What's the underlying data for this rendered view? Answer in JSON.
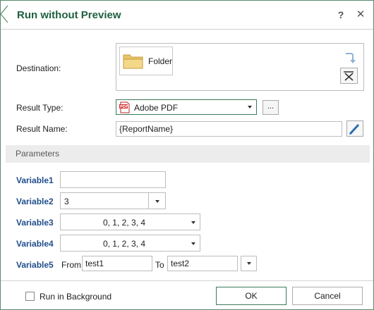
{
  "dialog": {
    "title": "Run without Preview",
    "help_glyph": "?",
    "close_glyph": "✕"
  },
  "labels": {
    "destination": "Destination:",
    "result_type": "Result Type:",
    "result_name": "Result Name:"
  },
  "destination": {
    "item_label": "Folder",
    "item_icon": "folder-icon"
  },
  "result_type": {
    "selected": "Adobe PDF",
    "icon": "pdf-icon",
    "browse_label": "..."
  },
  "result_name": {
    "value": "{ReportName}"
  },
  "parameters": {
    "section_title": "Parameters",
    "variable1": {
      "label": "Variable1",
      "value": ""
    },
    "variable2": {
      "label": "Variable2",
      "value": "3"
    },
    "variable3": {
      "label": "Variable3",
      "value": "0, 1, 2, 3, 4"
    },
    "variable4": {
      "label": "Variable4",
      "value": "0, 1, 2, 3, 4"
    },
    "variable5": {
      "label": "Variable5",
      "from_label": "From",
      "from_value": "test1",
      "to_label": "To",
      "to_value": "test2"
    }
  },
  "footer": {
    "run_in_background_label": "Run in Background",
    "run_in_background_checked": false,
    "ok_label": "OK",
    "cancel_label": "Cancel"
  },
  "colors": {
    "accent": "#1f5f3f",
    "variable_label": "#1f4e8c",
    "border_focus": "#3c7a5a"
  }
}
